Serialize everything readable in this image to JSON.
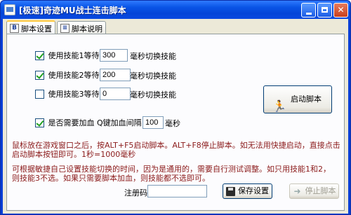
{
  "window": {
    "title": "[极速]奇迹MU战士连击脚本",
    "min_glyph": "",
    "max_glyph": "",
    "close_glyph": "✕"
  },
  "tabs": [
    {
      "label": "脚本设置",
      "icon": "B",
      "active": true
    },
    {
      "label": "脚本说明",
      "icon": "≡",
      "active": false
    }
  ],
  "skills": [
    {
      "label": "使用技能1等待",
      "value": "300",
      "unit": "毫秒切换技能",
      "checked": true
    },
    {
      "label": "使用技能2等待",
      "value": "200",
      "unit": "毫秒切换技能",
      "checked": true
    },
    {
      "label": "使用技能3等待",
      "value": "0",
      "unit": "毫秒切换技能",
      "checked": false
    }
  ],
  "heal": {
    "label": "是否需要加血  Q键加血间隔",
    "value": "100",
    "unit": "毫秒",
    "checked": true
  },
  "buttons": {
    "start": "启动脚本",
    "save": "保存设置",
    "stop": "停止脚本"
  },
  "notes": {
    "line1": "鼠标放在游戏窗口之后，按ALT+F5启动脚本。ALT+F8停止脚本。如无法用快捷启动，直接点击",
    "line2": "启动脚本按钮即可。1秒=1000毫秒",
    "line3": "可根据敏捷自己设置技能切换的时间，因为是通用的，需要自行测试调整。如只用技能1和2，",
    "line4": "则技能3不选。如果只需要脚本加血，则技能都不选即可。"
  },
  "register": {
    "label": "注册码",
    "value": ""
  },
  "colors": {
    "titlebar": "#0a55e6",
    "note_text": "#8b1a1a",
    "checkmark": "#21a121"
  }
}
